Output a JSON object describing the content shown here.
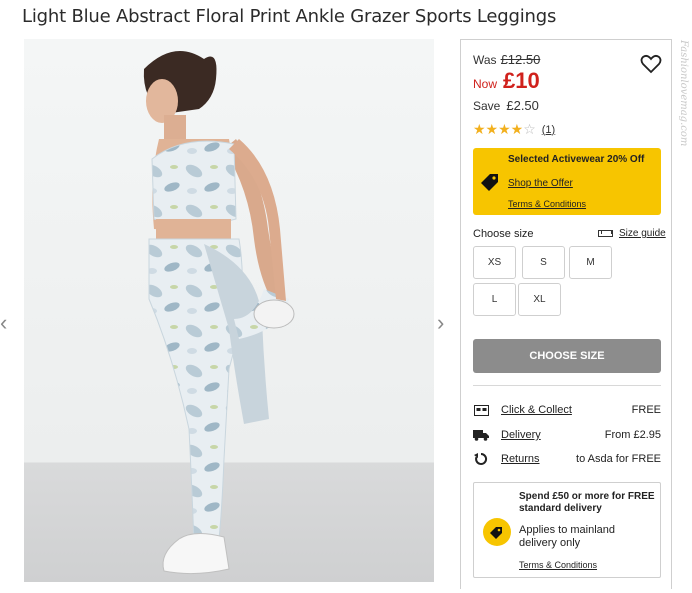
{
  "product": {
    "title": "Light Blue Abstract Floral Print Ankle Grazer Sports Leggings"
  },
  "gallery": {
    "prev_arrow": "‹",
    "next_arrow": "›"
  },
  "pricing": {
    "was_label": "Was",
    "was_price": "£12.50",
    "now_label": "Now",
    "now_price": "£10",
    "save_label": "Save",
    "save_amount": "£2.50"
  },
  "rating": {
    "value": 4,
    "max": 5,
    "stars_filled": "★★★★",
    "stars_empty": "☆",
    "review_count": "(1)"
  },
  "offer": {
    "title": "Selected Activewear 20% Off",
    "link": "Shop the Offer",
    "terms": "Terms & Conditions",
    "color": "#f7c500"
  },
  "sizes": {
    "label": "Choose size",
    "guide_label": "Size guide",
    "options": [
      "XS",
      "S",
      "M",
      "L",
      "XL"
    ]
  },
  "cta": {
    "label": "CHOOSE SIZE",
    "color": "#8c8c8c"
  },
  "delivery": [
    {
      "icon": "store-icon",
      "label": "Click & Collect",
      "value": "FREE"
    },
    {
      "icon": "truck-icon",
      "label": "Delivery",
      "value": "From £2.95"
    },
    {
      "icon": "returns-icon",
      "label": "Returns",
      "value": "to Asda for FREE"
    }
  ],
  "promo": {
    "title": "Spend £50 or more for FREE standard delivery",
    "text": "Applies to mainland delivery only",
    "terms": "Terms & Conditions"
  },
  "watermark": "Fashionlovemag.com"
}
